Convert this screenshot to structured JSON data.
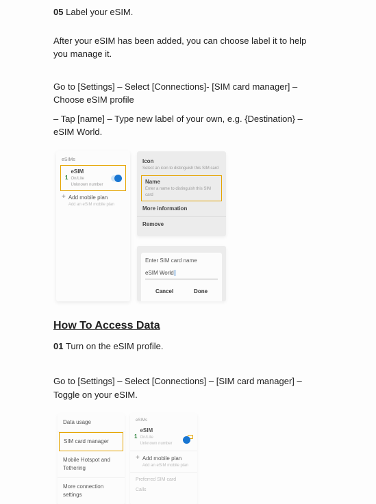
{
  "step05": {
    "num": "05",
    "title": "Label your eSIM."
  },
  "p1": "After your eSIM has been added, you can choose label it to help you manage it.",
  "instr1": "Go to [Settings] – Select [Connections]- [SIM card manager] – Choose eSIM profile",
  "instr2": "– Tap [name] – Type new label of your own, e.g. {Destination} – eSIM World.",
  "shot1": {
    "left": {
      "header": "eSIMs",
      "row1": {
        "num": "1",
        "title": "eSIM",
        "sub1": "On/Lite",
        "sub2": "Unknown number"
      },
      "row2": {
        "title": "Add mobile plan",
        "sub": "Add an eSIM mobile plan"
      }
    },
    "rightTop": {
      "icon": {
        "t": "Icon",
        "s": "Select an icon to distinguish this SIM card"
      },
      "name": {
        "t": "Name",
        "s": "Enter a name to distinguish this SIM card"
      },
      "more": "More information",
      "remove": "Remove"
    },
    "rightBot": {
      "label": "Enter SIM card name",
      "value": "eSIM World",
      "cancel": "Cancel",
      "done": "Done"
    }
  },
  "sectionTitle": "How To Access Data",
  "step01": {
    "num": "01",
    "title": "Turn on the eSIM profile."
  },
  "p2": "Go to [Settings] – Select [Connections] – [SIM card manager] – Toggle on your eSIM.",
  "shot2": {
    "left": {
      "r1": "Data usage",
      "r2": "SIM card manager",
      "r3": "Mobile Hotspot and Tethering",
      "r4": "More connection settings"
    },
    "right": {
      "hdr": "eSIMs",
      "row1": {
        "num": "1",
        "title": "eSIM",
        "sub1": "On/Lite",
        "sub2": "Unknown number"
      },
      "row2": {
        "title": "Add mobile plan",
        "sub": "Add an eSIM mobile plan"
      },
      "g1": "Preferred SIM card",
      "g2": "Calls"
    }
  }
}
